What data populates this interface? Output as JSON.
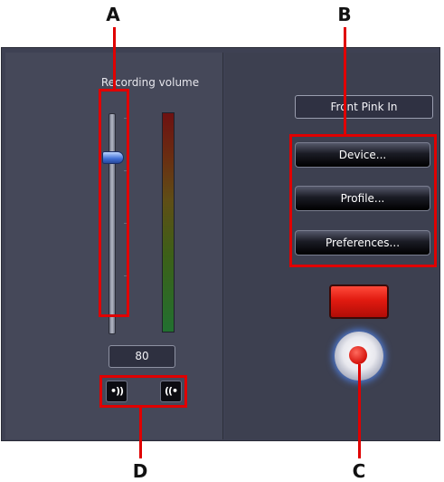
{
  "recording": {
    "volume_label": "Recording volume",
    "volume_value": "80",
    "volume_level_fraction": 0.8,
    "meter_colors": [
      "#6e1111",
      "#5f4e16",
      "#227030"
    ]
  },
  "speakers": {
    "left_label": "•))",
    "right_label": "((•"
  },
  "device": {
    "input_name": "Front Pink In",
    "device_button": "Device...",
    "profile_button": "Profile...",
    "preferences_button": "Preferences..."
  },
  "record": {
    "indicator_color": "#e11a10",
    "button_icon": "record-icon"
  },
  "callouts": {
    "a": "A",
    "b": "B",
    "c": "C",
    "d": "D"
  },
  "colors": {
    "callout_red": "#e00000",
    "panel_bg": "#454859"
  }
}
